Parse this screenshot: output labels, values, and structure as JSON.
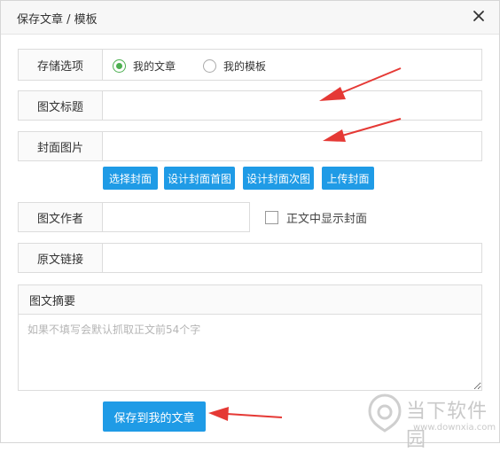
{
  "dialog": {
    "title": "保存文章 / 模板",
    "close_icon": "close-icon"
  },
  "storage": {
    "label": "存储选项",
    "options": [
      {
        "label": "我的文章",
        "selected": true
      },
      {
        "label": "我的模板",
        "selected": false
      }
    ]
  },
  "fields": {
    "title": {
      "label": "图文标题",
      "value": ""
    },
    "cover": {
      "label": "封面图片",
      "value": ""
    },
    "author": {
      "label": "图文作者",
      "value": ""
    },
    "source": {
      "label": "原文链接",
      "value": ""
    }
  },
  "cover_buttons": [
    "选择封面",
    "设计封面首图",
    "设计封面次图",
    "上传封面"
  ],
  "show_cover": {
    "label": "正文中显示封面",
    "checked": false
  },
  "summary": {
    "label": "图文摘要",
    "placeholder": "如果不填写会默认抓取正文前54个字",
    "value": ""
  },
  "save_button": "保存到我的文章",
  "watermark": {
    "text": "当下软件园",
    "url": "www.downxia.com"
  },
  "colors": {
    "accent": "#1f9be6",
    "radio_on": "#4caf50",
    "arrow": "#e53935"
  }
}
